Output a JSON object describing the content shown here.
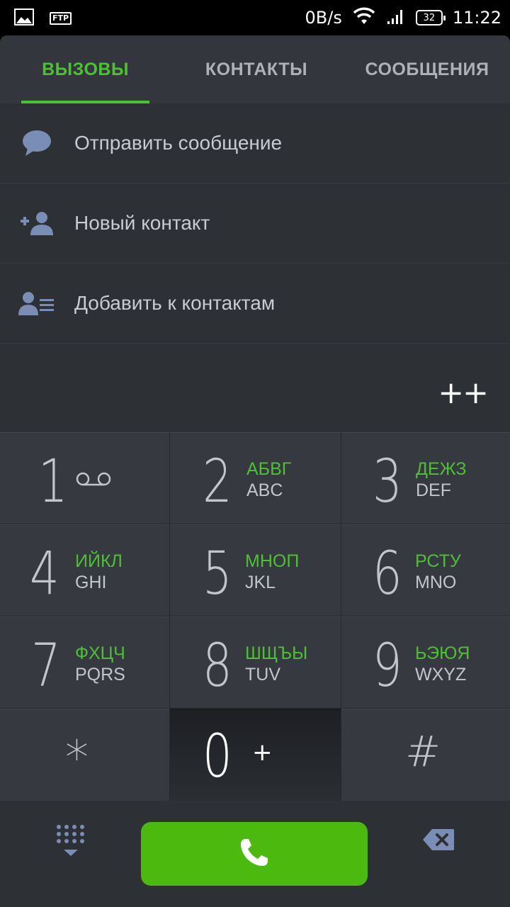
{
  "status_bar": {
    "icons": [
      "image-icon",
      "ftp-icon",
      "wifi-icon",
      "signal-icon"
    ],
    "ftp_label": "FTP",
    "speed": "0B/s",
    "battery": "32",
    "time": "11:22"
  },
  "tabs": [
    {
      "label": "ВЫЗОВЫ",
      "active": true
    },
    {
      "label": "КОНТАКТЫ",
      "active": false
    },
    {
      "label": "СООБЩЕНИЯ",
      "active": false
    }
  ],
  "menu": [
    {
      "label": "Отправить сообщение",
      "icon": "chat-bubble-icon"
    },
    {
      "label": "Новый контакт",
      "icon": "add-contact-icon"
    },
    {
      "label": "Добавить к контактам",
      "icon": "contact-list-icon"
    }
  ],
  "number_display": "++",
  "keys": [
    {
      "digit": "1",
      "ru": "",
      "en": "",
      "extra_icon": "voicemail-icon"
    },
    {
      "digit": "2",
      "ru": "АБВГ",
      "en": "ABC"
    },
    {
      "digit": "3",
      "ru": "ДЕЖЗ",
      "en": "DEF"
    },
    {
      "digit": "4",
      "ru": "ИЙКЛ",
      "en": "GHI"
    },
    {
      "digit": "5",
      "ru": "МНОП",
      "en": "JKL"
    },
    {
      "digit": "6",
      "ru": "РСТУ",
      "en": "MNO"
    },
    {
      "digit": "7",
      "ru": "ФХЦЧ",
      "en": "PQRS"
    },
    {
      "digit": "8",
      "ru": "ШЩЪЫ",
      "en": "TUV"
    },
    {
      "digit": "9",
      "ru": "ЬЭЮЯ",
      "en": "WXYZ"
    },
    {
      "digit": "*"
    },
    {
      "digit": "0",
      "plus": "+"
    },
    {
      "digit": "#"
    }
  ],
  "bottom_bar": {
    "left_icon": "dialpad-toggle-icon",
    "call_icon": "phone-icon",
    "right_icon": "backspace-icon"
  },
  "colors": {
    "accent": "#4cc132",
    "call_button": "#4cb90e",
    "background": "#2b2e33",
    "key": "#36393f"
  }
}
